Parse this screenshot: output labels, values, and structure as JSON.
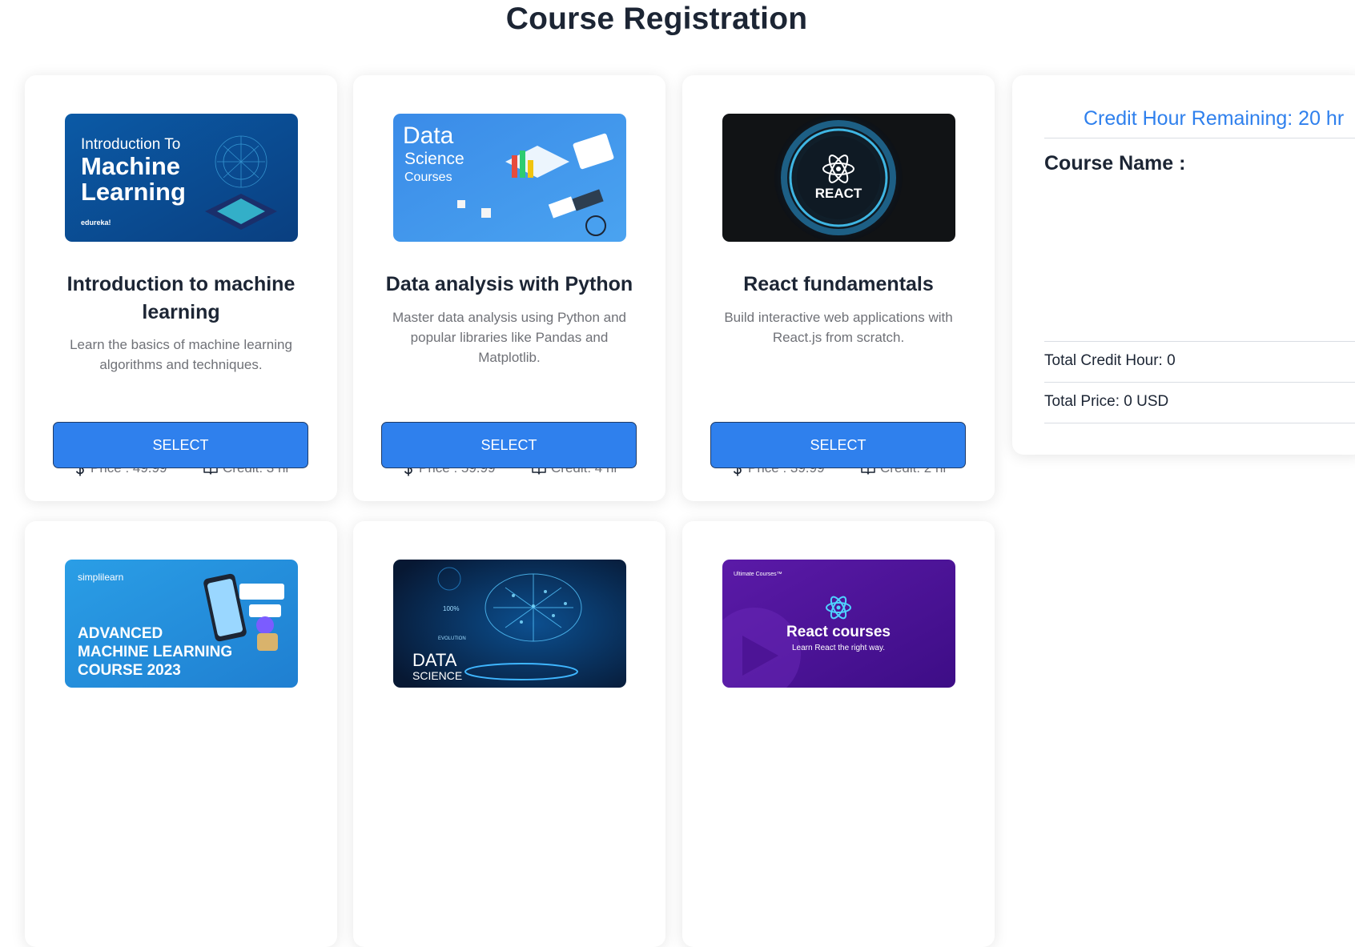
{
  "page": {
    "title": "Course Registration"
  },
  "labels": {
    "price_prefix": "Price : ",
    "credit_prefix": "Credit: ",
    "credit_suffix": " hr",
    "select": "SELECT"
  },
  "courses": [
    {
      "title": "Introduction to machine learning",
      "description": "Learn the basics of machine learning algorithms and techniques.",
      "price_text": "Price : 49.99",
      "credit_text": "Credit: 3 hr",
      "select_label": "SELECT",
      "image_text": {
        "line1": "Introduction To",
        "line2": "Machine",
        "line3": "Learning",
        "brand": "edureka!"
      }
    },
    {
      "title": "Data analysis with Python",
      "description": "Master data analysis using Python and popular libraries like Pandas and Matplotlib.",
      "price_text": "Price : 59.99",
      "credit_text": "Credit: 4 hr",
      "select_label": "SELECT",
      "image_text": {
        "line1": "Data",
        "line2": "Science",
        "line3": "Courses"
      }
    },
    {
      "title": "React fundamentals",
      "description": "Build interactive web applications with React.js from scratch.",
      "price_text": "Price : 39.99",
      "credit_text": "Credit: 2 hr",
      "select_label": "SELECT",
      "image_text": {
        "line1": "REACT"
      }
    },
    {
      "image_text": {
        "brand": "simplilearn",
        "line1": "ADVANCED",
        "line2": "MACHINE LEARNING",
        "line3": "COURSE 2023"
      }
    },
    {
      "image_text": {
        "line1": "DATA",
        "line2": "SCIENCE",
        "line3": "100%",
        "line4": "EVOLUTION"
      }
    },
    {
      "image_text": {
        "brand": "Ultimate Courses™",
        "line1": "React courses",
        "line2": "Learn React the right way."
      }
    }
  ],
  "summary": {
    "credit_remaining": "Credit Hour Remaining: 20 hr",
    "course_name_label": "Course Name :",
    "total_credit": "Total Credit Hour: 0",
    "total_price": "Total Price: 0 USD"
  },
  "colors": {
    "accent": "#2f80ed",
    "text": "#1c2534",
    "muted": "#6f7177"
  }
}
